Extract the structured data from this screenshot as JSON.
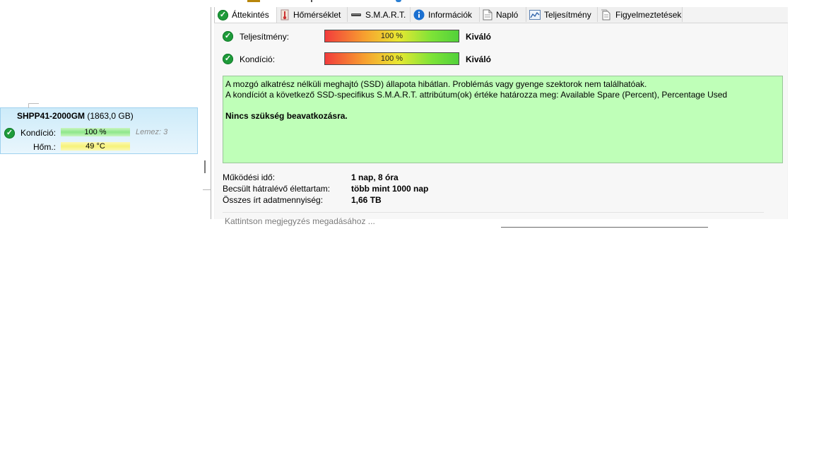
{
  "disk": {
    "model": "SHPP41-2000GM",
    "size": "(1863,0 GB)",
    "health_label": "Kondíció:",
    "health_value": "100 %",
    "disk_number": "Lemez: 3",
    "temp_label": "Hőm.:",
    "temp_value": "49 °C"
  },
  "tabs": [
    {
      "label": "Áttekintés",
      "icon": "ok-check-icon",
      "active": true
    },
    {
      "label": "Hőmérséklet",
      "icon": "thermometer-icon"
    },
    {
      "label": "S.M.A.R.T.",
      "icon": "drive-icon"
    },
    {
      "label": "Információk",
      "icon": "info-icon"
    },
    {
      "label": "Napló",
      "icon": "document-icon"
    },
    {
      "label": "Teljesítmény",
      "icon": "chart-icon"
    },
    {
      "label": "Figyelmeztetések",
      "icon": "alerts-icon"
    }
  ],
  "overview": {
    "performance": {
      "label": "Teljesítmény:",
      "value": "100 %",
      "percent": 100,
      "rating": "Kiváló"
    },
    "health": {
      "label": "Kondíció:",
      "value": "100 %",
      "percent": 100,
      "rating": "Kiváló"
    },
    "status_lines": [
      "A mozgó alkatrész nélküli meghajtó (SSD) állapota hibátlan. Problémás vagy gyenge szektorok nem találhatóak.",
      "A kondíciót a következő SSD-specifikus S.M.A.R.T. attribútum(ok) értéke határozza meg:  Available Spare (Percent), Percentage Used"
    ],
    "status_action": "Nincs szükség beavatkozásra.",
    "power_on_label": "Működési idő:",
    "power_on_value": "1 nap, 8 óra",
    "lifetime_label": "Becsült hátralévő élettartam:",
    "lifetime_value": "több mint 1000 nap",
    "written_label": "Összes írt adatmennyiség:",
    "written_value": "1,66 TB",
    "comment_placeholder": "Kattintson megjegyzés megadásához ..."
  },
  "colors": {
    "status_bg": "#bfffb8",
    "card_bg": "#cdebf9",
    "ok_green": "#1e9b3a"
  }
}
